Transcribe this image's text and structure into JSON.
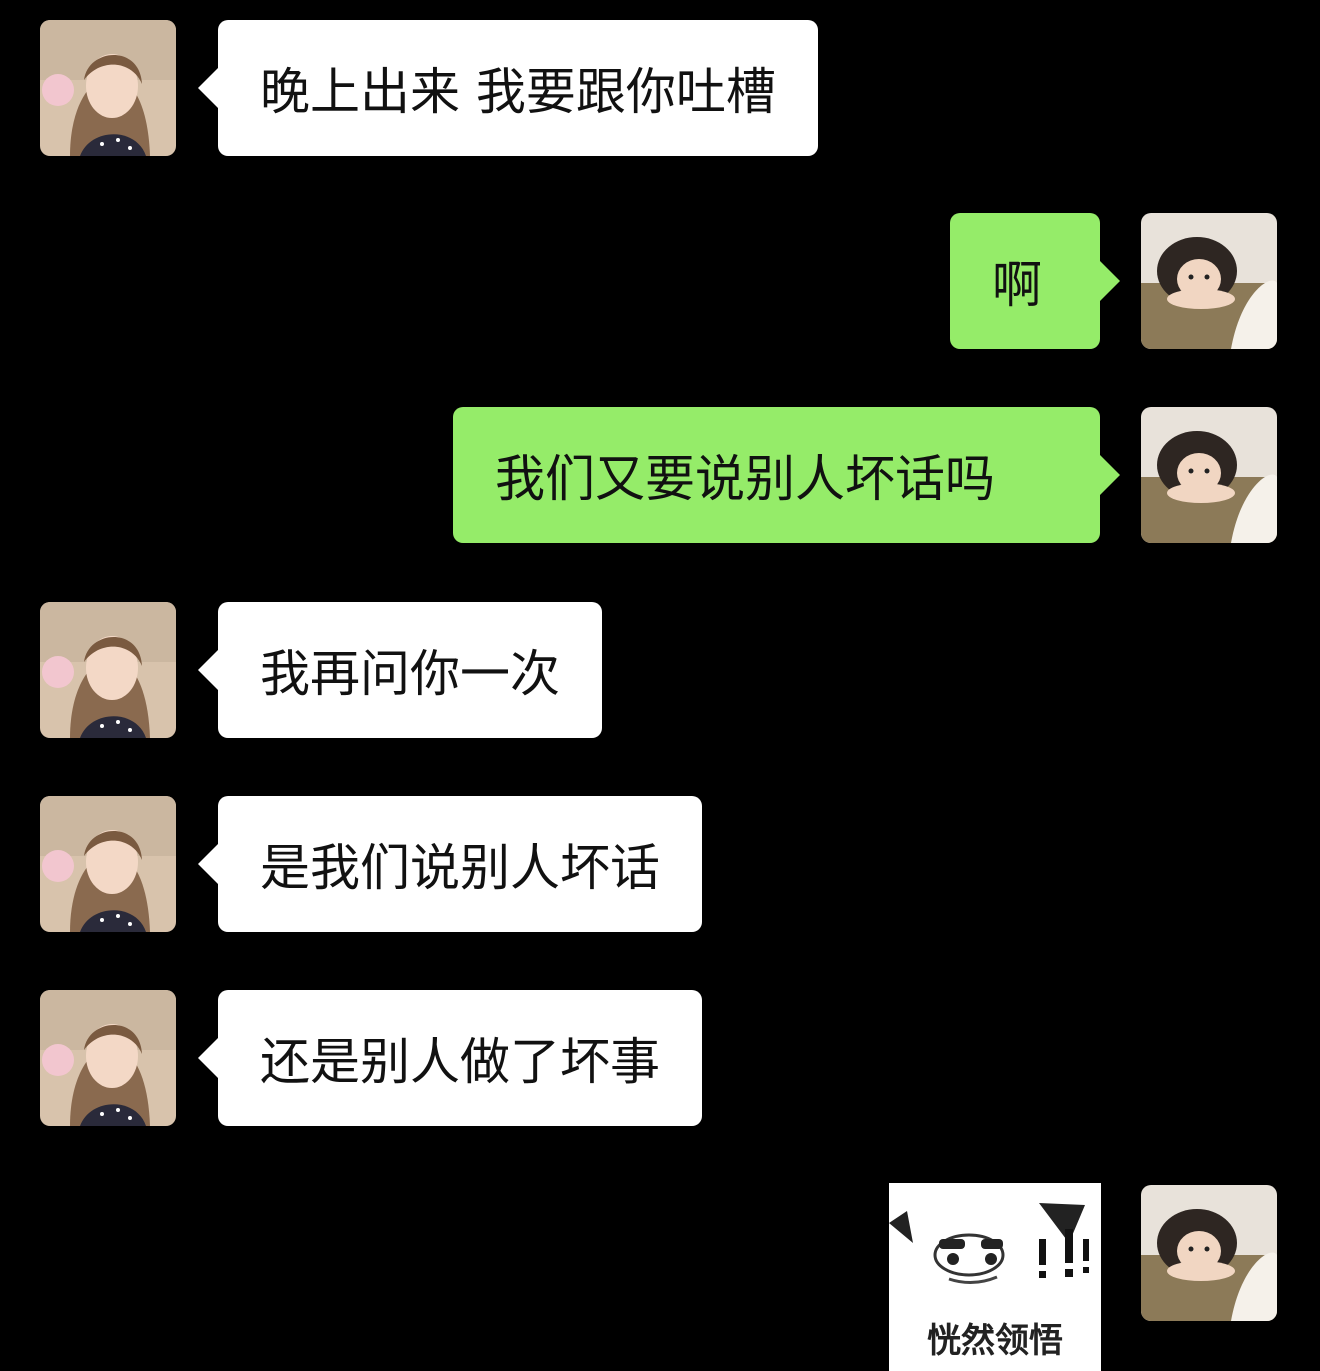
{
  "messages": [
    {
      "side": "left",
      "text": "晚上出来 我要跟你吐槽"
    },
    {
      "side": "right",
      "text": "啊"
    },
    {
      "side": "right",
      "text": "我们又要说别人坏话吗"
    },
    {
      "side": "left",
      "text": "我再问你一次"
    },
    {
      "side": "left",
      "text": "是我们说别人坏话"
    },
    {
      "side": "left",
      "text": "还是别人做了坏事"
    },
    {
      "side": "right",
      "type": "sticker",
      "caption": "恍然领悟"
    }
  ],
  "colors": {
    "background": "#000000",
    "incoming_bubble": "#ffffff",
    "outgoing_bubble": "#95ec69"
  },
  "icons": {
    "incoming_avatar": "avatar-girl-long-hair",
    "outgoing_avatar": "avatar-girl-lying-down",
    "sticker": "enlightened-face-sticker"
  }
}
